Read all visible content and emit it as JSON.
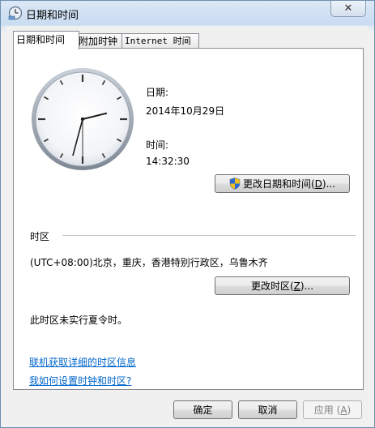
{
  "window": {
    "title": "日期和时间",
    "close_glyph": "✕"
  },
  "tabs": [
    {
      "label": "日期和时间"
    },
    {
      "label": "附加时钟"
    },
    {
      "label": "Internet 时间"
    }
  ],
  "date": {
    "label": "日期:",
    "value": "2014年10月29日"
  },
  "time": {
    "label": "时间:",
    "value": "14:32:30"
  },
  "change_datetime_button": {
    "label": "更改日期和时间(",
    "accel": "D",
    "suffix": ")..."
  },
  "timezone": {
    "section_label": "时区",
    "value": "(UTC+08:00)北京，重庆，香港特别行政区，乌鲁木齐",
    "change_button": {
      "label": "更改时区(",
      "accel": "Z",
      "suffix": ")..."
    },
    "dst_note": "此时区未实行夏令时。"
  },
  "links": {
    "online_info": "联机获取详细的时区信息",
    "how_to": "我如何设置时钟和时区?"
  },
  "footer": {
    "ok": "确定",
    "cancel": "取消",
    "apply": {
      "label": "应用 (",
      "accel": "A",
      "suffix": ")"
    }
  },
  "clock_state": {
    "hour": 14,
    "minute": 32,
    "second": 30
  }
}
